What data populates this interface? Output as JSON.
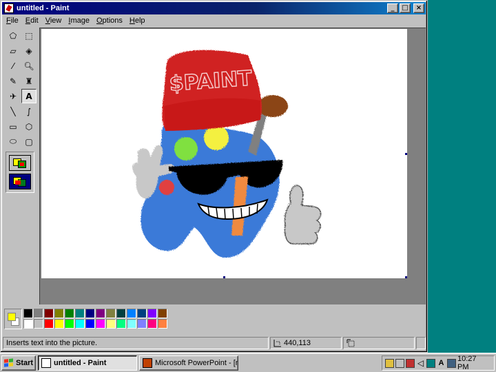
{
  "window": {
    "title": "untitled - Paint",
    "minimize_glyph": "_",
    "maximize_glyph": "□",
    "close_glyph": "×"
  },
  "menu": [
    {
      "label": "File",
      "accel": "F",
      "rest": "ile"
    },
    {
      "label": "Edit",
      "accel": "E",
      "rest": "dit"
    },
    {
      "label": "View",
      "accel": "V",
      "rest": "iew"
    },
    {
      "label": "Image",
      "accel": "I",
      "rest": "mage"
    },
    {
      "label": "Options",
      "accel": "O",
      "rest": "ptions"
    },
    {
      "label": "Help",
      "accel": "H",
      "rest": "elp"
    }
  ],
  "tools": [
    {
      "name": "free-form-select",
      "glyph": "⬠"
    },
    {
      "name": "select",
      "glyph": "⬚"
    },
    {
      "name": "eraser",
      "glyph": "▱"
    },
    {
      "name": "fill-with-color",
      "glyph": "◈"
    },
    {
      "name": "pick-color",
      "glyph": "⁄"
    },
    {
      "name": "magnifier",
      "glyph": "🔍︎"
    },
    {
      "name": "pencil",
      "glyph": "✎"
    },
    {
      "name": "brush",
      "glyph": "♜"
    },
    {
      "name": "airbrush",
      "glyph": "✈"
    },
    {
      "name": "text",
      "glyph": "A"
    },
    {
      "name": "line",
      "glyph": "╲"
    },
    {
      "name": "curve",
      "glyph": "∫"
    },
    {
      "name": "rectangle",
      "glyph": "▭"
    },
    {
      "name": "polygon",
      "glyph": "⬡"
    },
    {
      "name": "ellipse",
      "glyph": "⬭"
    },
    {
      "name": "rounded-rectangle",
      "glyph": "▢"
    }
  ],
  "active_tool": "text",
  "palette": {
    "current_foreground": "#ffff00",
    "current_background": "#ffffff",
    "colors": [
      "#000000",
      "#808080",
      "#800000",
      "#808000",
      "#008000",
      "#008080",
      "#000080",
      "#800080",
      "#808040",
      "#004040",
      "#0080ff",
      "#004080",
      "#8000ff",
      "#804000",
      "#ffffff",
      "#c0c0c0",
      "#ff0000",
      "#ffff00",
      "#00ff00",
      "#00ffff",
      "#0000ff",
      "#ff00ff",
      "#ffff80",
      "#00ff80",
      "#80ffff",
      "#8080ff",
      "#ff0080",
      "#ff8040"
    ]
  },
  "status": {
    "help_text": "Inserts text into the picture.",
    "cursor_position": "440,113",
    "selection_size": ""
  },
  "drawing": {
    "cap_text": "$PAINT"
  },
  "taskbar": {
    "start_label": "Start",
    "tasks": [
      {
        "label": "untitled - Paint",
        "active": true
      },
      {
        "label": "Microsoft PowerPoint - [mo...",
        "active": false
      }
    ],
    "clock": "10:27 PM"
  },
  "colors": {
    "desktop": "#008080",
    "title_active": "#000080",
    "face": "#c0c0c0",
    "canvas_bg": "#808080"
  }
}
